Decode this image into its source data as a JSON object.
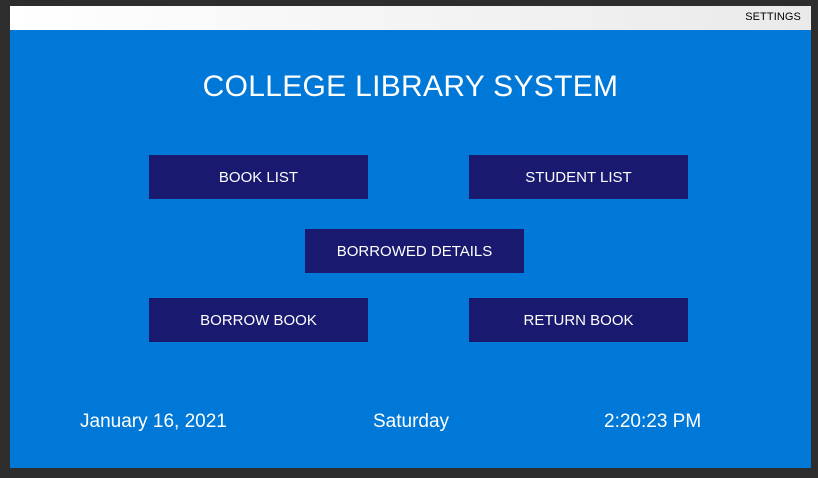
{
  "menu": {
    "settings_label": "SETTINGS"
  },
  "header": {
    "title": "COLLEGE LIBRARY SYSTEM"
  },
  "buttons": {
    "book_list": "BOOK LIST",
    "student_list": "STUDENT LIST",
    "borrowed_details": "BORROWED DETAILS",
    "borrow_book": "BORROW BOOK",
    "return_book": "RETURN BOOK"
  },
  "footer": {
    "date": "January 16, 2021",
    "day": "Saturday",
    "time": "2:20:23 PM"
  },
  "colors": {
    "background": "#0078d7",
    "button": "#191970",
    "text": "#ffffff"
  }
}
